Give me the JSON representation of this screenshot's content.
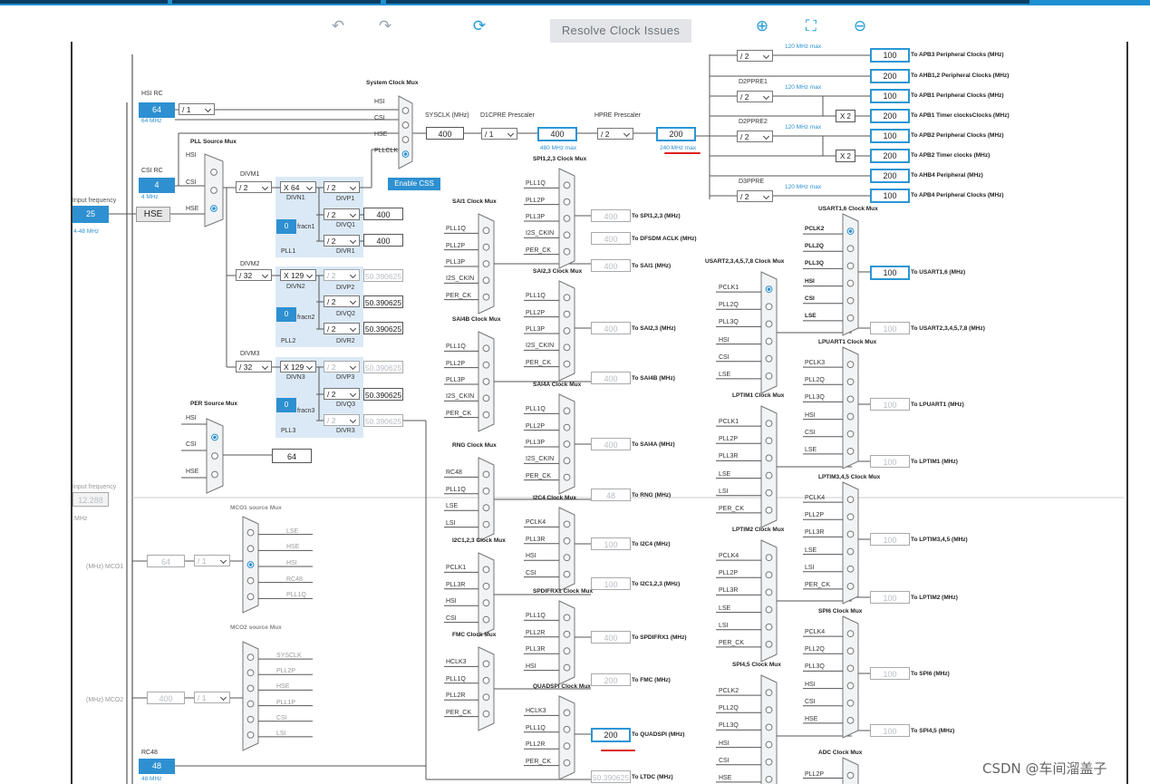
{
  "toolbar": {
    "resolve_label": "Resolve Clock Issues",
    "icons": [
      "undo-icon",
      "redo-icon",
      "refresh-icon",
      "zoom-in-icon",
      "fit-icon",
      "zoom-out-icon"
    ]
  },
  "inputs": {
    "hsi_rc_label": "HSI RC",
    "hsi_rc_value": "64",
    "hsi_rc_freq": "64 MHz",
    "csi_rc_label": "CSI RC",
    "csi_rc_value": "4",
    "csi_rc_freq": "4 MHz",
    "input_freq_label": "Input frequency",
    "input_freq_value": "25",
    "input_freq_range": "4-48 MHz",
    "input_freq2_label": "Input frequency",
    "input_freq2_value": "12.288",
    "input_freq2_unit": "MHz",
    "hse_label": "HSE",
    "rc48_label": "RC48",
    "rc48_value": "48",
    "rc48_freq": "48 MHz"
  },
  "hsi_div": "/ 1",
  "pll": {
    "source_mux": "PLL Source Mux",
    "src_hsi": "HSI",
    "src_csi": "CSI",
    "src_hse": "HSE",
    "divm1": "DIVM1",
    "divm1_val": "/ 2",
    "divm2": "DIVM2",
    "divm2_val": "/ 32",
    "divm3": "DIVM3",
    "divm3_val": "/ 32",
    "divn1": "DIVN1",
    "divn1_val": "X 64",
    "divn2": "DIVN2",
    "divn2_val": "X 129",
    "divn3": "DIVN3",
    "divn3_val": "X 129",
    "fracn": "fracn1",
    "fracn2": "fracn2",
    "fracn3": "fracn3",
    "frac_val": "0",
    "pll1": "PLL1",
    "pll2": "PLL2",
    "pll3": "PLL3",
    "divp1": "DIVP1",
    "divq1": "DIVQ1",
    "divr1": "DIVR1",
    "divp2": "DIVP2",
    "divq2": "DIVQ2",
    "divr2": "DIVR2",
    "divp3": "DIVP3",
    "divq3": "DIVQ3",
    "divr3": "DIVR3",
    "div2": "/ 2",
    "p1_out": "400",
    "q1_out": "400",
    "r1_out": "400",
    "p2_out": "50.390625",
    "q2_out": "50.390625",
    "r2_out": "50.390625",
    "p3_out": "50.390625",
    "q3_out": "50.390625",
    "r3_out": "50.390625"
  },
  "sysclk": {
    "mux": "System Clock Mux",
    "hsi": "HSI",
    "csi": "CSI",
    "hse": "HSE",
    "pllclk": "PLLCLK",
    "label": "SYSCLK (MHz)",
    "value": "400",
    "d1cpre": "D1CPRE Prescaler",
    "d1cpre_val": "/ 1",
    "d1_out": "400",
    "d1_max": "480 MHz max",
    "hpre": "HPRE Prescaler",
    "hpre_val": "/ 2",
    "hpre_out": "200",
    "hpre_max": "240 MHz max",
    "enable_css": "Enable CSS"
  },
  "bus": [
    {
      "div": "/ 2",
      "max": "120 MHz max",
      "value": "100",
      "label": "To APB3 Peripheral Clocks (MHz)"
    },
    {
      "div": "",
      "max": "",
      "value": "200",
      "label": "To AHB1,2 Peripheral Clocks (MHz)"
    },
    {
      "div": "/ 2",
      "max": "120 MHz max",
      "value": "100",
      "label": "To APB1 Peripheral Clocks (MHz)",
      "pre": "D2PPRE1"
    },
    {
      "div": "",
      "max": "",
      "value": "200",
      "label": "To APB1 Timer clocksClocks (MHz)",
      "mul": "X 2"
    },
    {
      "div": "/ 2",
      "max": "120 MHz max",
      "value": "100",
      "label": "To APB2 Peripheral Clocks (MHz)",
      "pre": "D2PPRE2"
    },
    {
      "div": "",
      "max": "",
      "value": "200",
      "label": "To APB2 Timer clocks (MHz)",
      "mul": "X 2"
    },
    {
      "div": "",
      "max": "",
      "value": "200",
      "label": "To AHB4 Peripheral (MHz)"
    },
    {
      "div": "/ 2",
      "max": "120 MHz max",
      "value": "100",
      "label": "To APB4 Peripheral Clocks (MHz)",
      "pre": "D3PPRE"
    }
  ],
  "per_mux": {
    "title": "PER Source Mux",
    "hsi": "HSI",
    "csi": "CSI",
    "hse": "HSE",
    "out": "64"
  },
  "mco1": {
    "title": "MCO1 source Mux",
    "inputs": [
      "LSE",
      "HSE",
      "HSI",
      "RC48",
      "PLL1Q"
    ],
    "div": "/ 1",
    "value": "64",
    "label": "(MHz) MCO1"
  },
  "mco2": {
    "title": "MCO2 source Mux",
    "inputs": [
      "SYSCLK",
      "PLL2P",
      "HSE",
      "PLL1P",
      "CSI",
      "LSI"
    ],
    "div": "/ 1",
    "value": "400",
    "label": "(MHz) MCO2"
  },
  "col2": [
    {
      "title": "SAI1 Clock Mux",
      "inputs": [
        "PLL1Q",
        "PLL2P",
        "PLL3P",
        "I2S_CKIN",
        "PER_CK"
      ]
    },
    {
      "title": "SAI4B Clock Mux",
      "inputs": [
        "PLL1Q",
        "PLL2P",
        "PLL3P",
        "I2S_CKIN",
        "PER_CK"
      ]
    },
    {
      "title": "RNG Clock Mux",
      "inputs": [
        "RC48",
        "PLL1Q",
        "LSE",
        "LSI"
      ]
    },
    {
      "title": "I2C1,2,3 Clock Mux",
      "inputs": [
        "PCLK1",
        "PLL3R",
        "HSI",
        "CSI"
      ]
    },
    {
      "title": "FMC Clock Mux",
      "inputs": [
        "HCLK3",
        "PLL1Q",
        "PLL2R",
        "PER_CK"
      ]
    }
  ],
  "col3": [
    {
      "title": "SPI1,2,3 Clock Mux",
      "inputs": [
        "PLL1Q",
        "PLL2P",
        "PLL3P",
        "I2S_CKIN",
        "PER_CK"
      ],
      "value": "400",
      "label": "To SPI1,2,3 (MHz)"
    },
    {
      "title": "",
      "inputs": [],
      "value": "400",
      "label": "To DFSDM ACLK (MHz)"
    },
    {
      "title": "",
      "inputs": [],
      "value": "400",
      "label": "To SAI1 (MHz)"
    },
    {
      "title": "SAI2,3 Clock Mux",
      "inputs": [
        "PLL1Q",
        "PLL2P",
        "PLL3P",
        "I2S_CKIN",
        "PER_CK"
      ],
      "value": "400",
      "label": "To SAI2,3 (MHz)"
    },
    {
      "title": "",
      "inputs": [],
      "value": "400",
      "label": "To SAI4B (MHz)"
    },
    {
      "title": "SAI4A Clock Mux",
      "inputs": [
        "PLL1Q",
        "PLL2P",
        "PLL3P",
        "I2S_CKIN",
        "PER_CK"
      ],
      "value": "400",
      "label": "To SAI4A (MHz)"
    },
    {
      "title": "",
      "inputs": [],
      "value": "48",
      "label": "To RNG (MHz)"
    },
    {
      "title": "I2C4 Clock Mux",
      "inputs": [
        "PCLK4",
        "PLL3R",
        "HSI",
        "CSI"
      ],
      "value": "100",
      "label": "To I2C4 (MHz)"
    },
    {
      "title": "",
      "inputs": [],
      "value": "100",
      "label": "To I2C1,2,3 (MHz)"
    },
    {
      "title": "SPDIFRX1 Clock Mux",
      "inputs": [
        "PLL1Q",
        "PLL2R",
        "PLL3R",
        "HSI"
      ],
      "value": "400",
      "label": "To SPDIFRX1 (MHz)"
    },
    {
      "title": "",
      "inputs": [],
      "value": "200",
      "label": "To FMC (MHz)"
    },
    {
      "title": "QUADSPI Clock Mux",
      "inputs": [
        "HCLK3",
        "PLL1Q",
        "PLL2R",
        "PER_CK"
      ],
      "value": "200",
      "label": "To QUADSPI (MHz)"
    },
    {
      "title": "",
      "inputs": [],
      "value": "50.390625",
      "label": "To LTDC (MHz)"
    }
  ],
  "col4": [
    {
      "title": "USART2,3,4,5,7,8 Clock Mux",
      "inputs": [
        "PCLK1",
        "PLL2Q",
        "PLL3Q",
        "HSI",
        "CSI",
        "LSE"
      ]
    },
    {
      "title": "LPTIM1 Clock Mux",
      "inputs": [
        "PCLK1",
        "PLL2P",
        "PLL3R",
        "LSE",
        "LSI",
        "PER_CK"
      ]
    },
    {
      "title": "LPTIM2 Clock Mux",
      "inputs": [
        "PCLK4",
        "PLL2P",
        "PLL3R",
        "LSE",
        "LSI",
        "PER_CK"
      ]
    },
    {
      "title": "SPI4,5 Clock Mux",
      "inputs": [
        "PCLK2",
        "PLL2Q",
        "PLL3Q",
        "HSI",
        "CSI",
        "HSE"
      ]
    }
  ],
  "col5": [
    {
      "title": "USART1,6 Clock Mux",
      "inputs": [
        "PCLK2",
        "PLL2Q",
        "PLL3Q",
        "HSI",
        "CSI",
        "LSE"
      ],
      "value": "100",
      "label": "To USART1,6 (MHz)"
    },
    {
      "title": "",
      "inputs": [],
      "value": "100",
      "label": "To USART2,3,4,5,7,8 (MHz)"
    },
    {
      "title": "LPUART1 Clock Mux",
      "inputs": [
        "PCLK3",
        "PLL2Q",
        "PLL3Q",
        "HSI",
        "CSI",
        "LSE"
      ],
      "value": "100",
      "label": "To LPUART1 (MHz)"
    },
    {
      "title": "",
      "inputs": [],
      "value": "100",
      "label": "To LPTIM1 (MHz)"
    },
    {
      "title": "LPTIM3,4,5 Clock Mux",
      "inputs": [
        "PCLK4",
        "PLL2P",
        "PLL3R",
        "LSE",
        "LSI",
        "PER_CK"
      ],
      "value": "100",
      "label": "To LPTIM3,4,5 (MHz)"
    },
    {
      "title": "",
      "inputs": [],
      "value": "100",
      "label": "To LPTIM2 (MHz)"
    },
    {
      "title": "SPI6 Clock Mux",
      "inputs": [
        "PCLK4",
        "PLL2Q",
        "PLL3Q",
        "HSI",
        "CSI",
        "HSE"
      ],
      "value": "100",
      "label": "To SPI6 (MHz)"
    },
    {
      "title": "",
      "inputs": [],
      "value": "100",
      "label": "To SPI4,5 (MHz)"
    },
    {
      "title": "ADC Clock Mux",
      "inputs": [
        "PLL2P"
      ],
      "value": "",
      "label": ""
    }
  ],
  "watermark": "CSDN @车间溜盖子"
}
